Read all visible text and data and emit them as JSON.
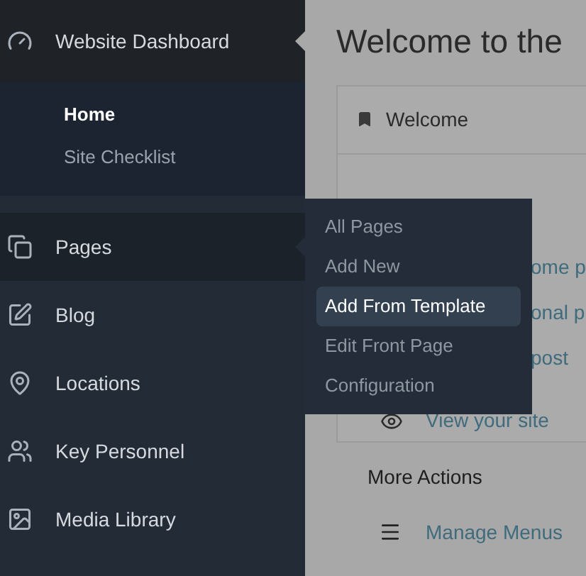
{
  "sidebar": {
    "items": [
      {
        "kind": "gauge",
        "label": "Website Dashboard",
        "selected": true,
        "expanded": false,
        "children": [
          {
            "label": "Home",
            "selected": true
          },
          {
            "label": "Site Checklist",
            "selected": false
          }
        ]
      },
      {
        "kind": "pages",
        "label": "Pages",
        "selected": false,
        "expanded": true
      },
      {
        "kind": "blog",
        "label": "Blog",
        "selected": false,
        "expanded": false
      },
      {
        "kind": "pin",
        "label": "Locations",
        "selected": false,
        "expanded": false
      },
      {
        "kind": "people",
        "label": "Key Personnel",
        "selected": false,
        "expanded": false
      },
      {
        "kind": "image",
        "label": "Media Library",
        "selected": false,
        "expanded": false
      }
    ]
  },
  "flyout": {
    "items": [
      {
        "label": "All Pages",
        "selected": false
      },
      {
        "label": "Add New",
        "selected": false
      },
      {
        "label": "Add From Template",
        "selected": true
      },
      {
        "label": "Edit Front Page",
        "selected": false
      },
      {
        "label": "Configuration",
        "selected": false
      }
    ]
  },
  "main": {
    "title": "Welcome to the",
    "panel": {
      "title": "Welcome",
      "links": [
        {
          "label": "ome p"
        },
        {
          "label": "onal p"
        },
        {
          "label": "post"
        },
        {
          "label": "View your site",
          "kind": "eye"
        }
      ]
    },
    "more_actions": {
      "title": "More Actions",
      "links": [
        {
          "label": "Manage Menus",
          "kind": "menu"
        }
      ]
    }
  }
}
